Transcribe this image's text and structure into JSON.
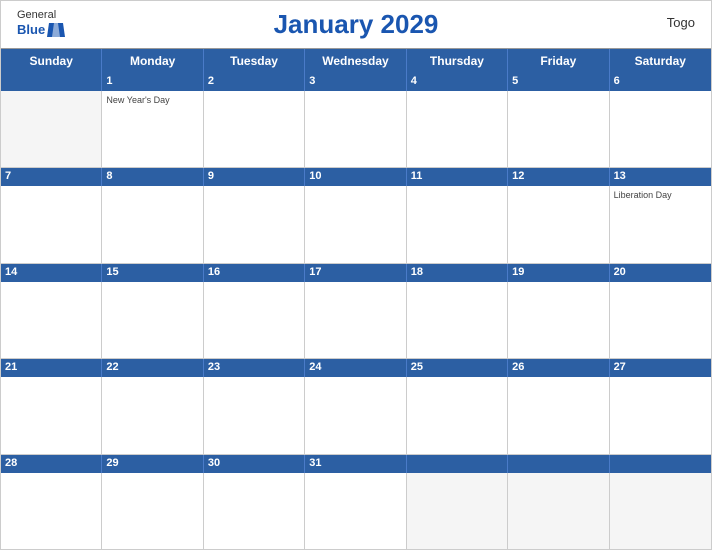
{
  "header": {
    "title": "January 2029",
    "country": "Togo",
    "logo": {
      "general": "General",
      "blue": "Blue"
    }
  },
  "dayHeaders": [
    "Sunday",
    "Monday",
    "Tuesday",
    "Wednesday",
    "Thursday",
    "Friday",
    "Saturday"
  ],
  "weeks": [
    {
      "numbers": [
        "",
        "1",
        "2",
        "3",
        "4",
        "5",
        "6"
      ],
      "holidays": [
        "",
        "New Year's Day",
        "",
        "",
        "",
        "",
        ""
      ]
    },
    {
      "numbers": [
        "7",
        "8",
        "9",
        "10",
        "11",
        "12",
        "13"
      ],
      "holidays": [
        "",
        "",
        "",
        "",
        "",
        "",
        "Liberation Day"
      ]
    },
    {
      "numbers": [
        "14",
        "15",
        "16",
        "17",
        "18",
        "19",
        "20"
      ],
      "holidays": [
        "",
        "",
        "",
        "",
        "",
        "",
        ""
      ]
    },
    {
      "numbers": [
        "21",
        "22",
        "23",
        "24",
        "25",
        "26",
        "27"
      ],
      "holidays": [
        "",
        "",
        "",
        "",
        "",
        "",
        ""
      ]
    },
    {
      "numbers": [
        "28",
        "29",
        "30",
        "31",
        "",
        "",
        ""
      ],
      "holidays": [
        "",
        "",
        "",
        "",
        "",
        "",
        ""
      ]
    }
  ],
  "colors": {
    "header_blue": "#2c5fa3",
    "accent_blue": "#1a56b0",
    "border": "#ccc",
    "text_dark": "#222",
    "text_white": "#fff"
  }
}
